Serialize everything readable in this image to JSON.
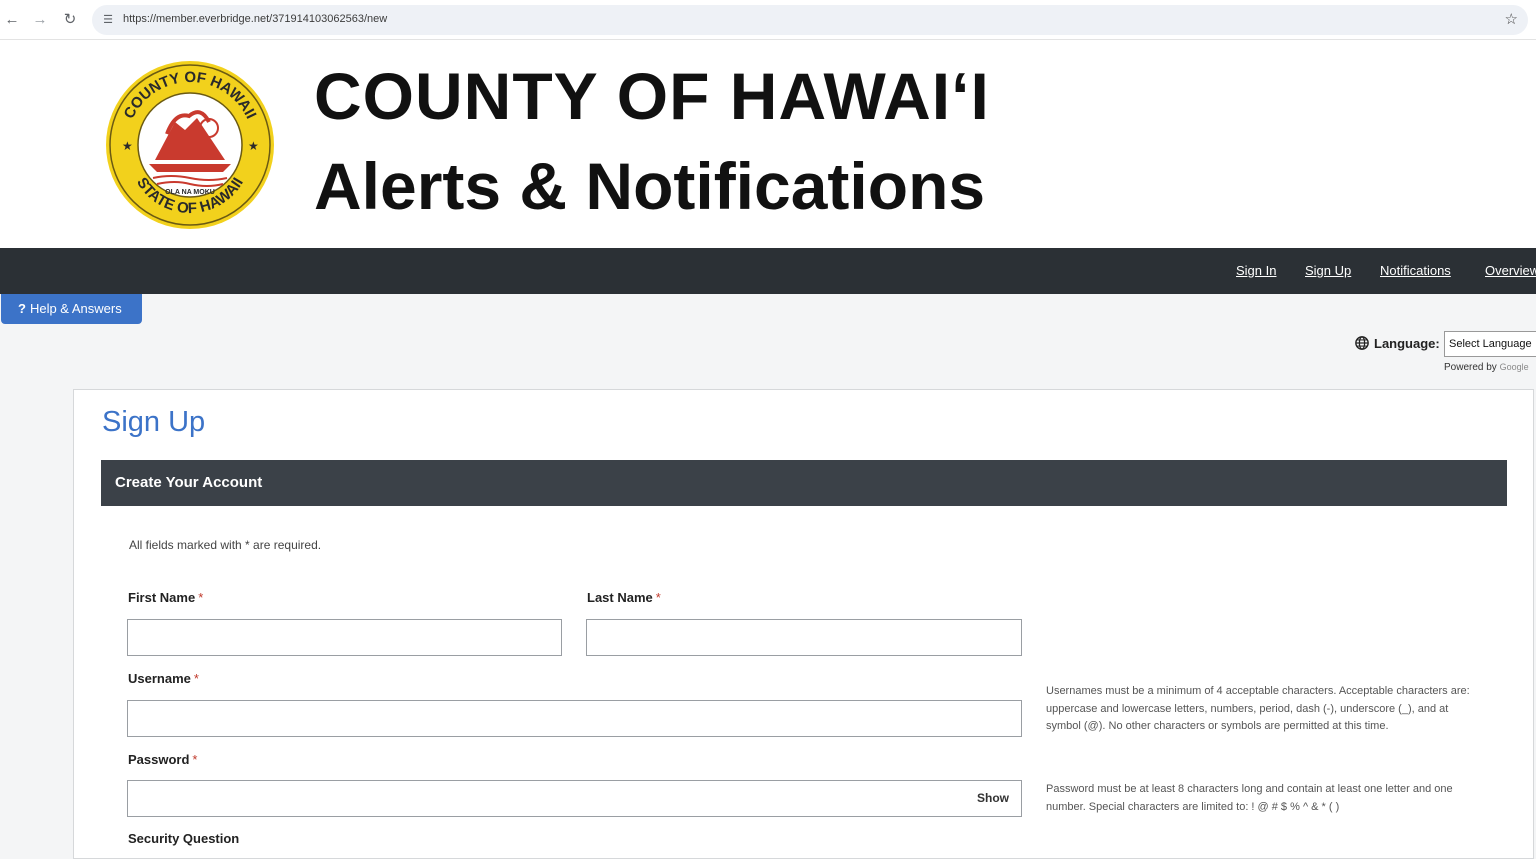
{
  "browser": {
    "url": "https://member.everbridge.net/371914103062563/new"
  },
  "header": {
    "seal_text_top": "COUNTY OF HAWAII",
    "seal_text_bottom": "STATE OF HAWAII",
    "seal_motto": "OLA NA MOKU",
    "title_line1": "COUNTY OF HAWAIʻI",
    "title_line2": "Alerts & Notifications"
  },
  "nav": {
    "items": [
      {
        "label": "Sign In"
      },
      {
        "label": "Sign Up"
      },
      {
        "label": "Notifications"
      },
      {
        "label": "Overview"
      }
    ]
  },
  "help": {
    "label": "Help & Answers"
  },
  "language": {
    "label": "Language:",
    "selected": "Select Language",
    "powered_by": "Powered by",
    "powered_brand": "Google"
  },
  "form": {
    "page_title": "Sign Up",
    "section_title": "Create Your Account",
    "required_note": "All fields marked with * are required.",
    "required_marker": "*",
    "first_name": {
      "label": "First Name",
      "value": ""
    },
    "last_name": {
      "label": "Last Name",
      "value": ""
    },
    "username": {
      "label": "Username",
      "value": "",
      "hint": "Usernames must be a minimum of 4 acceptable characters. Acceptable characters are: uppercase and lowercase letters, numbers, period, dash (-), underscore (_), and at symbol (@). No other characters or symbols are permitted at this time."
    },
    "password": {
      "label": "Password",
      "value": "",
      "show_label": "Show",
      "hint": "Password must be at least 8 characters long and contain at least one letter and one number. Special characters are limited to: ! @ # $ % ^ & * ( )"
    },
    "security_question": {
      "label": "Security Question"
    }
  },
  "colors": {
    "accent": "#3c73c8",
    "navbar": "#2b3035",
    "section_bar": "#3b4148",
    "seal_gold": "#f2d11c",
    "seal_red": "#c93a2e",
    "required_star": "#c0392b"
  },
  "icons": {
    "back": "arrow-left-icon",
    "forward": "arrow-right-icon",
    "reload": "reload-icon",
    "site_info": "tune-icon",
    "bookmark": "star-icon",
    "help": "question-icon",
    "language": "globe-icon"
  }
}
